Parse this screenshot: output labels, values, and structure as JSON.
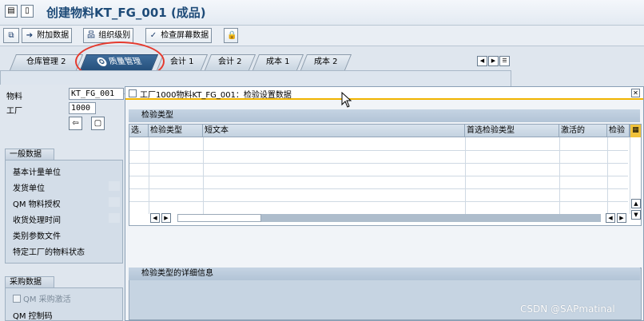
{
  "window": {
    "title": "创建物料KT_FG_001 (成品)",
    "icons": [
      "menu-icon",
      "page-icon"
    ]
  },
  "toolbar": {
    "additional_data_label": "附加数据",
    "org_levels_label": "组织级别",
    "check_screen_label": "检查屏幕数据"
  },
  "tabs": [
    {
      "label": "仓库管理 2",
      "active": false
    },
    {
      "label": "质量管理",
      "active": true
    },
    {
      "label": "会计 1",
      "active": false
    },
    {
      "label": "会计 2",
      "active": false
    },
    {
      "label": "成本 1",
      "active": false
    },
    {
      "label": "成本 2",
      "active": false
    }
  ],
  "header": {
    "material_label": "物料",
    "material_value": "KT_FG_001",
    "plant_label": "工厂",
    "plant_value": "1000"
  },
  "general_data": {
    "title": "一般数据",
    "items": [
      "基本计量单位",
      "发货单位",
      "QM 物料授权",
      "收货处理时间",
      "类别参数文件",
      "特定工厂的物料状态"
    ]
  },
  "purchasing_data": {
    "title": "采购数据",
    "qm_active_label": "QM 采购激活",
    "qm_control_key_label": "QM 控制码"
  },
  "dialog": {
    "title": "工厂1000物料KT_FG_001：检验设置数据",
    "section_title": "检验类型",
    "columns": [
      "选.",
      "检验类型",
      "短文本",
      "首选检验类型",
      "激活的",
      "检验"
    ],
    "details_title": "检验类型的详细信息"
  },
  "watermark": "CSDN @SAPmatinal",
  "colors": {
    "active_tab": "#2f5d8b",
    "highlight_circle": "#e53a2e",
    "dialog_underline": "#f0b400"
  }
}
